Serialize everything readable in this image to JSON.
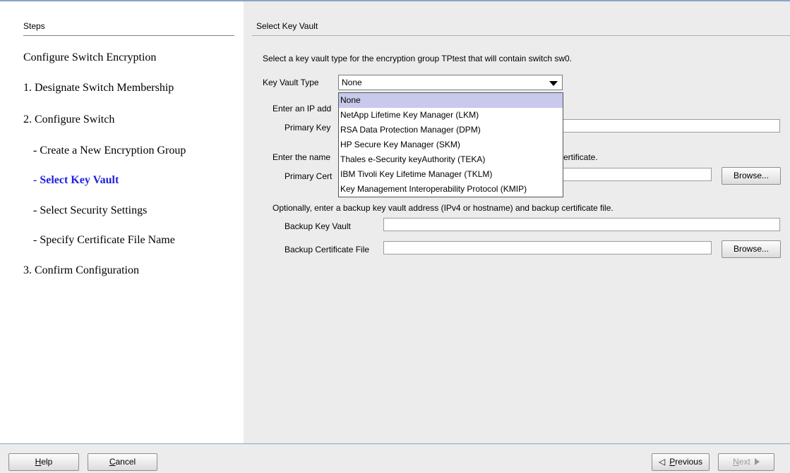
{
  "steps_panel": {
    "header": "Steps",
    "items": [
      {
        "label": "Configure Switch Encryption"
      },
      {
        "label": "1. Designate Switch Membership"
      },
      {
        "label": "2. Configure Switch"
      },
      {
        "label": "- Create a New Encryption Group"
      },
      {
        "label": "- Select Key Vault"
      },
      {
        "label": "- Select Security Settings"
      },
      {
        "label": "- Specify Certificate File Name"
      },
      {
        "label": "3. Confirm Configuration"
      }
    ]
  },
  "content": {
    "header": "Select Key Vault",
    "intro": "Select a key vault type for the encryption group TPtest that will contain switch sw0.",
    "key_vault_type_label": "Key Vault Type",
    "key_vault_type_value": "None",
    "enter_ip_text": "Enter an IP add",
    "primary_key_label": "Primary Key",
    "enter_name_text": "Enter the name",
    "enter_name_suffix": "ertificate.",
    "primary_cert_label": "Primary Cert",
    "browse_label": "Browse...",
    "optional_text": "Optionally, enter a backup key vault address (IPv4 or hostname) and backup certificate file.",
    "backup_key_vault_label": "Backup Key Vault",
    "backup_cert_label": "Backup Certificate File",
    "backup_key_vault_value": "",
    "backup_cert_value": "",
    "primary_key_value": "",
    "primary_cert_value": ""
  },
  "dropdown": {
    "options": [
      {
        "label": "None"
      },
      {
        "label": "NetApp Lifetime Key Manager (LKM)"
      },
      {
        "label": "RSA Data Protection Manager (DPM)"
      },
      {
        "label": "HP Secure Key Manager (SKM)"
      },
      {
        "label": "Thales e-Security keyAuthority (TEKA)"
      },
      {
        "label": "IBM Tivoli Key Lifetime Manager (TKLM)"
      },
      {
        "label": "Key Management Interoperability Protocol (KMIP)"
      }
    ],
    "selected": "None"
  },
  "footer": {
    "help": {
      "first": "H",
      "rest": "elp"
    },
    "cancel": {
      "first": "C",
      "rest": "ancel"
    },
    "previous": {
      "first": "P",
      "rest": "revious"
    },
    "next": {
      "first": "N",
      "rest": "ext"
    }
  }
}
